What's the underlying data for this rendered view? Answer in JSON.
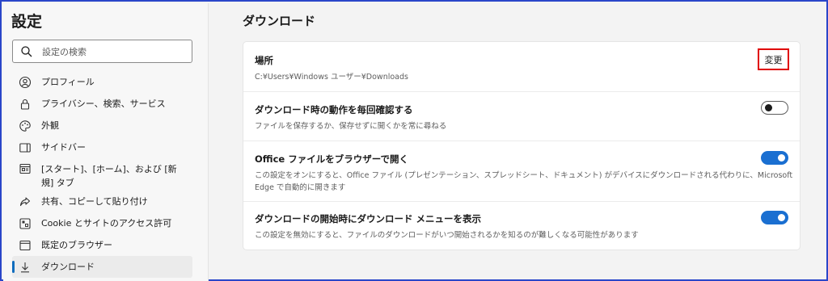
{
  "sidebar": {
    "title": "設定",
    "search_placeholder": "設定の検索",
    "items": [
      {
        "label": "プロフィール",
        "icon": "profile-icon"
      },
      {
        "label": "プライバシー、検索、サービス",
        "icon": "lock-icon"
      },
      {
        "label": "外観",
        "icon": "palette-icon"
      },
      {
        "label": "サイドバー",
        "icon": "sidebar-icon"
      },
      {
        "label": "[スタート]、[ホーム]、および [新規] タブ",
        "icon": "home-tabs-icon"
      },
      {
        "label": "共有、コピーして貼り付け",
        "icon": "share-icon"
      },
      {
        "label": "Cookie とサイトのアクセス許可",
        "icon": "cookie-icon"
      },
      {
        "label": "既定のブラウザー",
        "icon": "browser-icon"
      },
      {
        "label": "ダウンロード",
        "icon": "download-icon",
        "active": true
      }
    ]
  },
  "main": {
    "title": "ダウンロード",
    "location": {
      "title": "場所",
      "path": "C:¥Users¥Windows ユーザー¥Downloads",
      "button": "変更"
    },
    "ask_each": {
      "title": "ダウンロード時の動作を毎回確認する",
      "desc": "ファイルを保存するか、保存せずに開くかを常に尋ねる",
      "enabled": false
    },
    "office": {
      "title": "Office ファイルをブラウザーで開く",
      "desc": "この設定をオンにすると、Office ファイル (プレゼンテーション、スプレッドシート、ドキュメント) がデバイスにダウンロードされる代わりに、Microsoft Edge で自動的に開きます",
      "enabled": true
    },
    "show_menu": {
      "title": "ダウンロードの開始時にダウンロード メニューを表示",
      "desc": "この設定を無効にすると、ファイルのダウンロードがいつ開始されるかを知るのが難しくなる可能性があります",
      "enabled": true
    }
  },
  "colors": {
    "accent": "#1a6fd1",
    "highlight": "#e00000",
    "frame": "#2a46c9"
  }
}
